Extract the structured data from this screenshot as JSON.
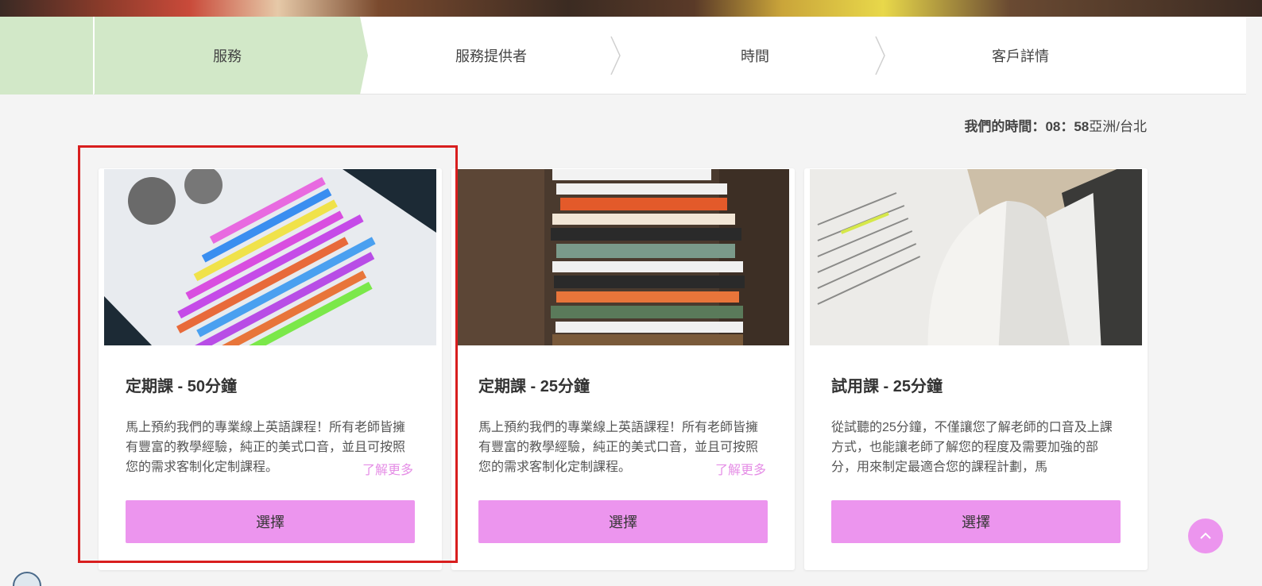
{
  "wizard": {
    "steps": [
      {
        "label": "服務",
        "active": true
      },
      {
        "label": "服務提供者",
        "active": false
      },
      {
        "label": "時間",
        "active": false
      },
      {
        "label": "客戶詳情",
        "active": false
      }
    ]
  },
  "time_info": {
    "label": "我們的時間：",
    "value": "08：58",
    "timezone": "亞洲/台北"
  },
  "services": [
    {
      "title": "定期課 - 50分鐘",
      "description": "馬上預約我們的專業線上英語課程！所有老師皆擁有豐富的教學經驗，純正的美式口音，並且可按照您的需求客制化定制課程。",
      "learn_more": "了解更多",
      "select_label": "選擇",
      "image_icon": "highlighted-book-photo"
    },
    {
      "title": "定期課 - 25分鐘",
      "description": "馬上預約我們的專業線上英語課程！所有老師皆擁有豐富的教學經驗，純正的美式口音，並且可按照您的需求客制化定制課程。",
      "learn_more": "了解更多",
      "select_label": "選擇",
      "image_icon": "book-stack-photo"
    },
    {
      "title": "試用課 - 25分鐘",
      "description": "從試聽的25分鐘，不僅讓您了解老師的口音及上課方式，也能讓老師了解您的程度及需要加強的部分，用來制定最適合您的課程計劃，馬",
      "select_label": "選擇",
      "image_icon": "open-book-photo"
    }
  ],
  "colors": {
    "accent": "#ec95ee",
    "link": "#e58ee6",
    "active_step": "#d2e8c8",
    "highlight": "#d81e1e"
  },
  "scroll_top_icon": "chevron-up-icon"
}
